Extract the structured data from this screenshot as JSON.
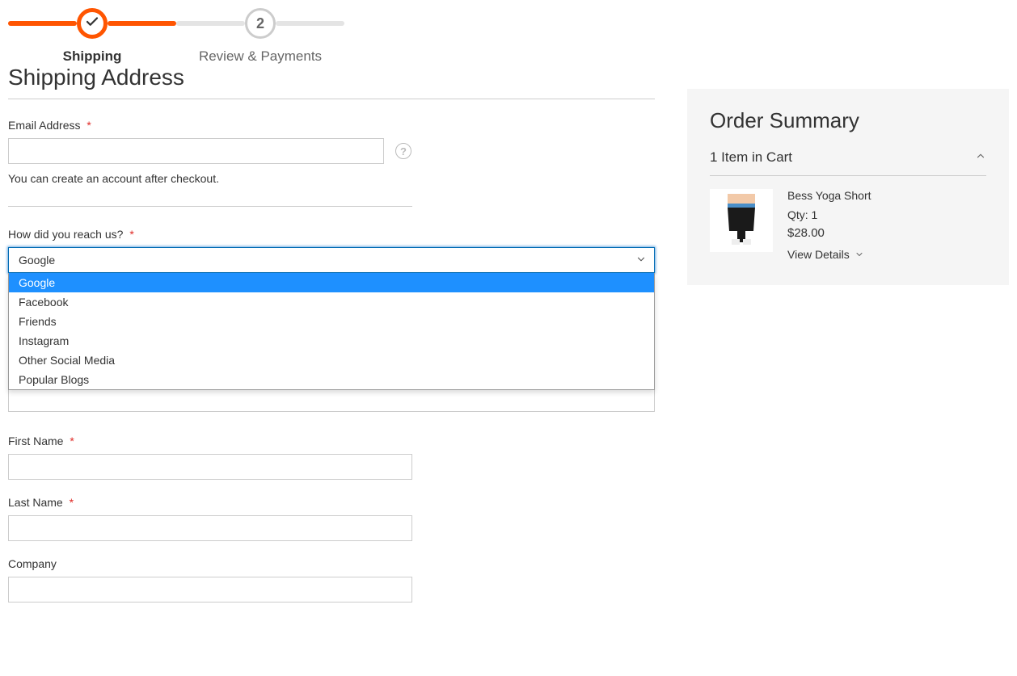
{
  "progress": {
    "step1_label": "Shipping",
    "step2_label": "Review & Payments",
    "step2_number": "2"
  },
  "page_title": "Shipping Address",
  "form": {
    "email": {
      "label": "Email Address",
      "value": "",
      "hint": "You can create an account after checkout."
    },
    "reach_us": {
      "label": "How did you reach us?",
      "selected": "Google",
      "options": [
        "Google",
        "Facebook",
        "Friends",
        "Instagram",
        "Other Social Media",
        "Popular Blogs"
      ]
    },
    "first_name": {
      "label": "First Name",
      "value": ""
    },
    "last_name": {
      "label": "Last Name",
      "value": ""
    },
    "company": {
      "label": "Company",
      "value": ""
    }
  },
  "summary": {
    "title": "Order Summary",
    "cart_count_label": "1 Item in Cart",
    "item": {
      "name": "Bess Yoga Short",
      "qty_label": "Qty: 1",
      "price": "$28.00",
      "view_details": "View Details"
    }
  },
  "colors": {
    "accent": "#ff5501",
    "focus": "#006bb4",
    "required": "#e02b27",
    "dropdown_highlight": "#1e90ff"
  }
}
